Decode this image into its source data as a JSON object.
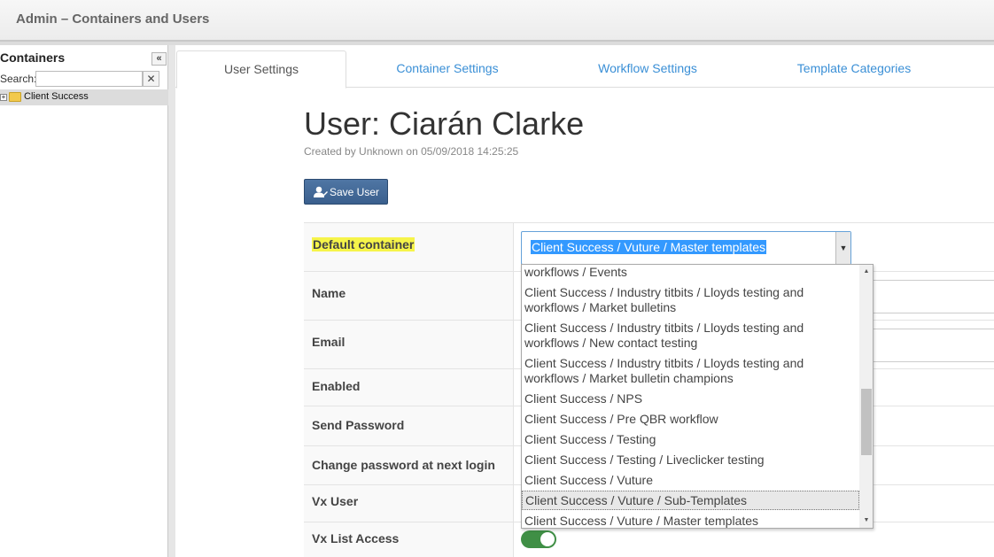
{
  "header": {
    "title": "Admin – Containers and Users"
  },
  "sidebar": {
    "title": "Containers",
    "collapse_glyph": "«",
    "search_label": "Search:",
    "search_value": "",
    "clear_glyph": "✕",
    "tree": [
      {
        "label": "Client Success",
        "expander": "+"
      }
    ]
  },
  "tabs": [
    {
      "label": "User Settings",
      "active": true
    },
    {
      "label": "Container Settings",
      "active": false
    },
    {
      "label": "Workflow Settings",
      "active": false
    },
    {
      "label": "Template Categories",
      "active": false
    }
  ],
  "user": {
    "title": "User: Ciarán Clarke",
    "created": "Created by Unknown on 05/09/2018 14:25:25"
  },
  "save_button": {
    "label": "Save User"
  },
  "form": {
    "rows": [
      {
        "label": "Default container",
        "highlighted": true
      },
      {
        "label": "Name"
      },
      {
        "label": "Email"
      },
      {
        "label": "Enabled"
      },
      {
        "label": "Send Password"
      },
      {
        "label": "Change password at next login"
      },
      {
        "label": "Vx User"
      },
      {
        "label": "Vx List Access"
      }
    ],
    "default_container_value": "Client Success / Vuture / Master templates",
    "vx_list_access": true
  },
  "dropdown": {
    "options": [
      [
        "workflows / Events"
      ],
      [
        "Client Success / Industry titbits / Lloyds testing and",
        "workflows / Market bulletins"
      ],
      [
        "Client Success / Industry titbits / Lloyds testing and",
        "workflows / New contact testing"
      ],
      [
        "Client Success / Industry titbits / Lloyds testing and",
        "workflows / Market bulletin champions"
      ],
      [
        "Client Success / NPS"
      ],
      [
        "Client Success / Pre QBR workflow"
      ],
      [
        "Client Success / Testing"
      ],
      [
        "Client Success / Testing / Liveclicker testing"
      ],
      [
        "Client Success / Vuture"
      ],
      [
        "Client Success / Vuture / Sub-Templates"
      ],
      [
        "Client Success / Vuture / Master templates"
      ]
    ],
    "hover_index": 9,
    "scroll_up": "▲",
    "scroll_down": "▼"
  },
  "colors": {
    "accent": "#3a8fd6",
    "button": "#3f6593",
    "toggle_on": "#3f8f45",
    "highlight": "#f6f44a"
  }
}
